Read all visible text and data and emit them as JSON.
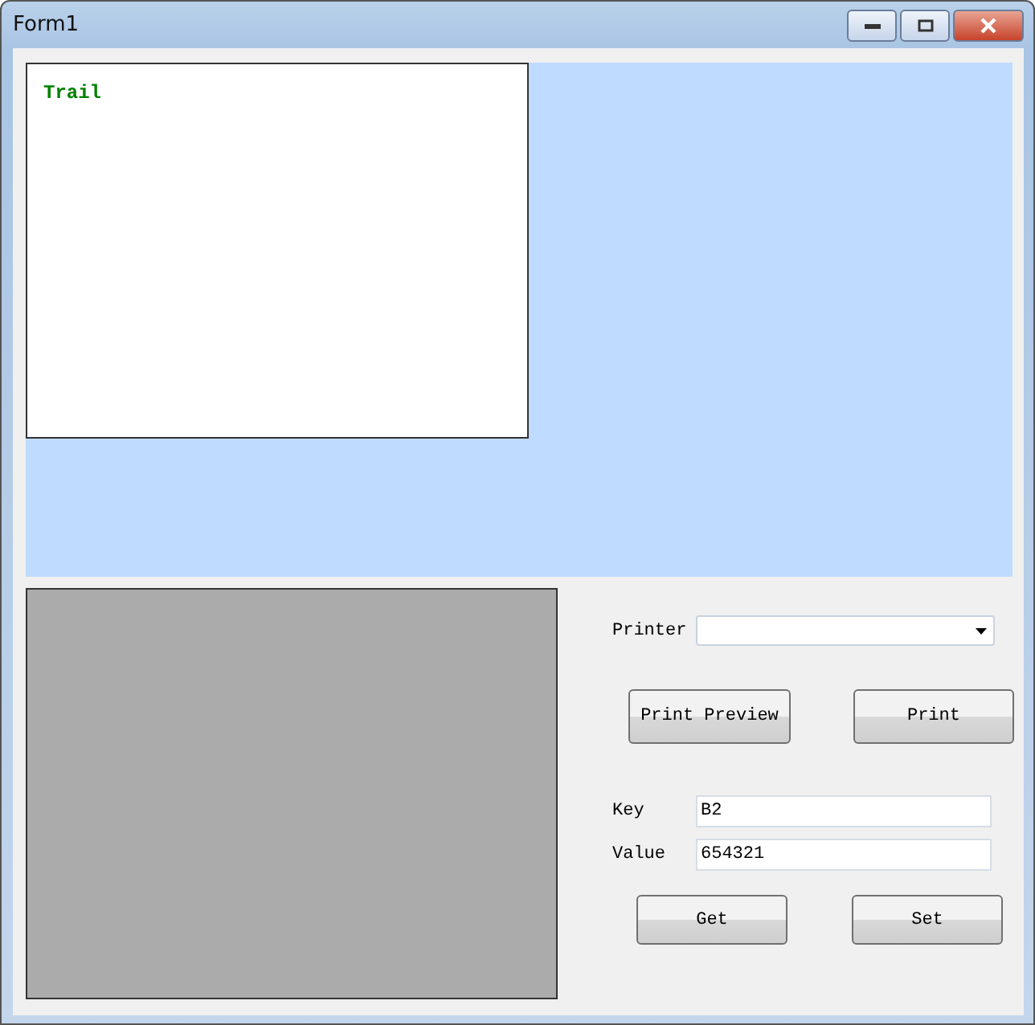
{
  "window": {
    "title": "Form1"
  },
  "preview": {
    "text": "Trail"
  },
  "printer": {
    "label": "Printer"
  },
  "print_buttons": [
    "Print Preview",
    "Print"
  ],
  "fields": [
    {
      "label": "Key",
      "value": "B2"
    },
    {
      "label": "Value",
      "value": "654321"
    }
  ],
  "action_buttons": [
    "Get",
    "Set"
  ]
}
